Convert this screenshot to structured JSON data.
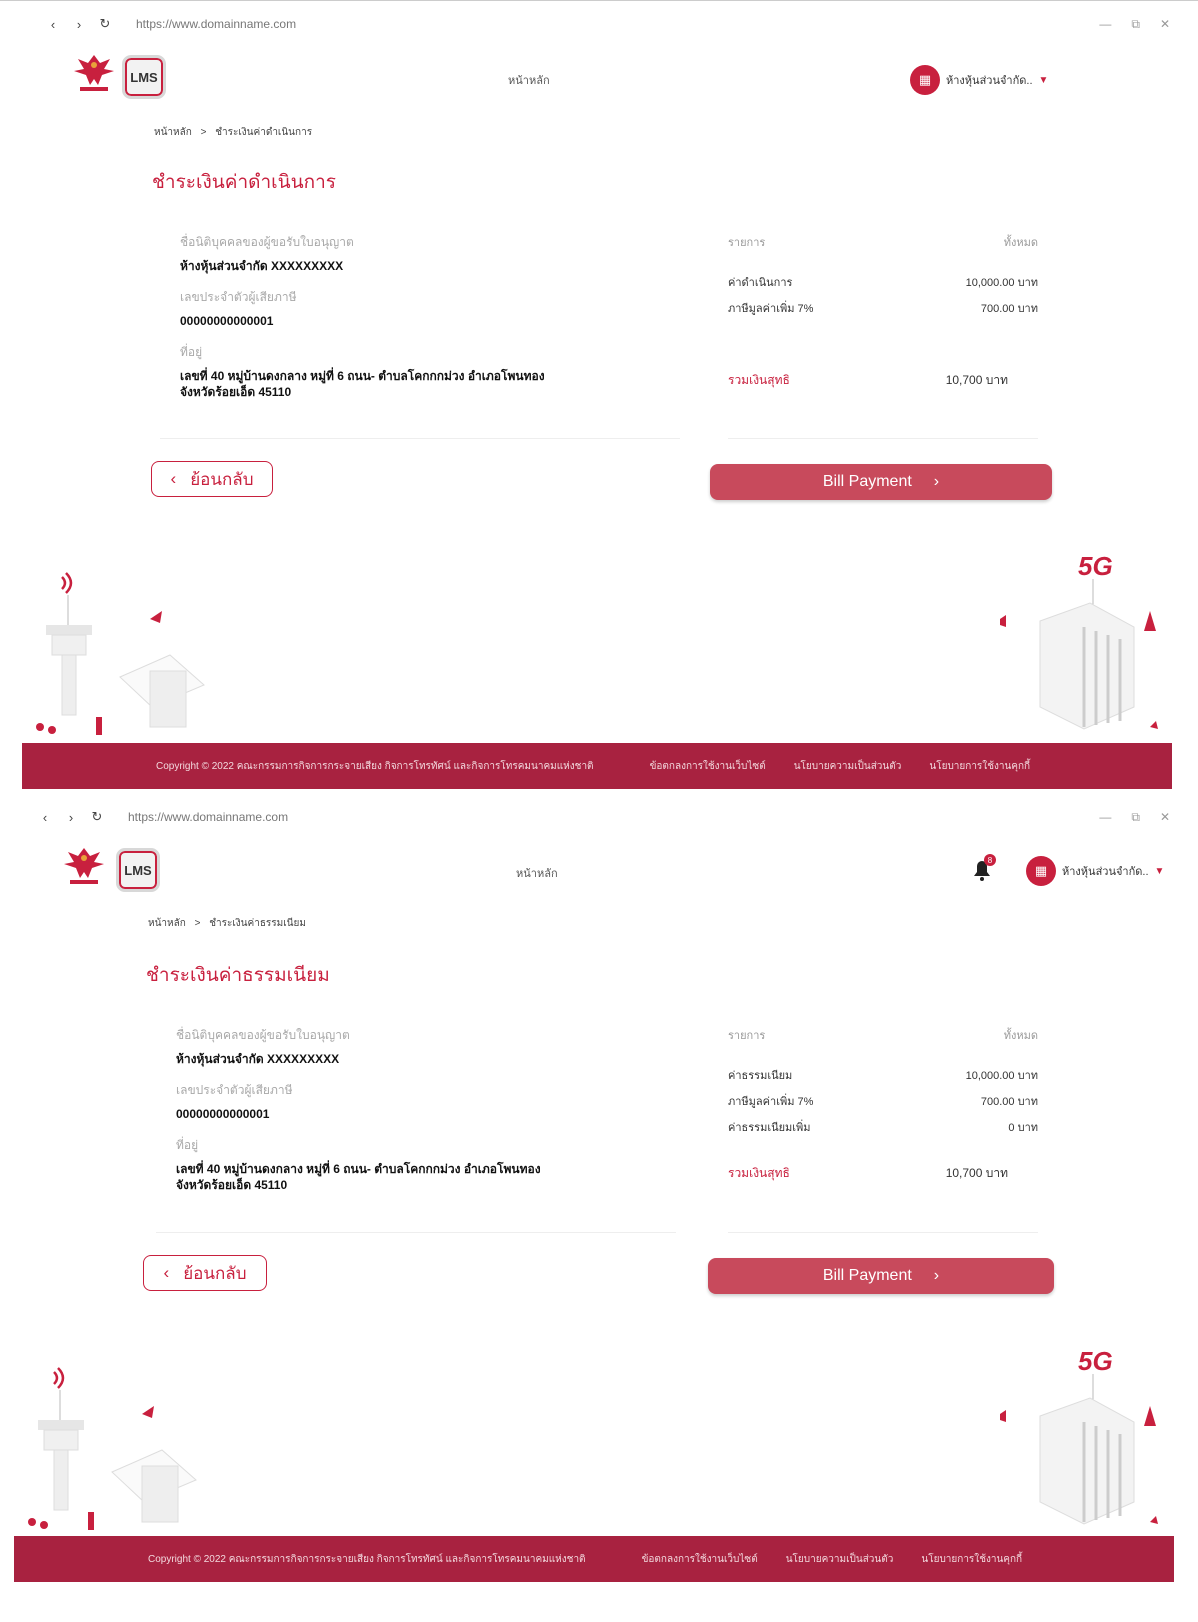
{
  "colors": {
    "accent": "#c8203e",
    "footer": "#a82240",
    "button": "#c84a5c"
  },
  "screens": [
    {
      "browser": {
        "url": "https://www.domainname.com"
      },
      "header": {
        "home_label": "หน้าหลัก",
        "org_label": "ห้างหุ้นส่วนจำกัด..",
        "lms_logo": "LMS"
      },
      "breadcrumb": {
        "home": "หน้าหลัก",
        "separator": ">",
        "current": "ชำระเงินค่าดำเนินการ"
      },
      "title": "ชำระเงินค่าดำเนินการ",
      "info": {
        "company_label": "ชื่อนิติบุคคลของผู้ขอรับใบอนุญาต",
        "company_value": "ห้างหุ้นส่วนจำกัด XXXXXXXXX",
        "taxid_label": "เลขประจำตัวผู้เสียภาษี",
        "taxid_value": "00000000000001",
        "address_label": "ที่อยู่",
        "address_line1": "เลขที่ 40 หมู่บ้านดงกลาง หมู่ที่ 6 ถนน- ตำบลโคกกกม่วง อำเภอโพนทอง",
        "address_line2": "จังหวัดร้อยเอ็ด 45110"
      },
      "fees": {
        "col_item": "รายการ",
        "col_total": "ทั้งหมด",
        "rows": [
          {
            "name": "ค่าดำเนินการ",
            "amount": "10,000.00 บาท"
          },
          {
            "name": "ภาษีมูลค่าเพิ่ม 7%",
            "amount": "700.00 บาท"
          }
        ],
        "total_label": "รวมเงินสุทธิ",
        "total_value": "10,700 บาท"
      },
      "buttons": {
        "back": "ย้อนกลับ",
        "bill": "Bill Payment"
      },
      "footer": {
        "copyright": "Copyright © 2022 คณะกรรมการกิจการกระจายเสียง กิจการโทรทัศน์ และกิจการโทรคมนาคมแห่งชาติ",
        "link1": "ข้อตกลงการใช้งานเว็บไซต์",
        "link2": "นโยบายความเป็นส่วนตัว",
        "link3": "นโยบายการใช้งานคุกกี้"
      },
      "illustration": {
        "badge": "5G"
      }
    },
    {
      "browser": {
        "url": "https://www.domainname.com"
      },
      "header": {
        "home_label": "หน้าหลัก",
        "org_label": "ห้างหุ้นส่วนจำกัด..",
        "lms_logo": "LMS",
        "bell_count": "8"
      },
      "breadcrumb": {
        "home": "หน้าหลัก",
        "separator": ">",
        "current": "ชำระเงินค่าธรรมเนียม"
      },
      "title": "ชำระเงินค่าธรรมเนียม",
      "info": {
        "company_label": "ชื่อนิติบุคคลของผู้ขอรับใบอนุญาต",
        "company_value": "ห้างหุ้นส่วนจำกัด XXXXXXXXX",
        "taxid_label": "เลขประจำตัวผู้เสียภาษี",
        "taxid_value": "00000000000001",
        "address_label": "ที่อยู่",
        "address_line1": "เลขที่ 40 หมู่บ้านดงกลาง หมู่ที่ 6 ถนน- ตำบลโคกกกม่วง อำเภอโพนทอง",
        "address_line2": "จังหวัดร้อยเอ็ด 45110"
      },
      "fees": {
        "col_item": "รายการ",
        "col_total": "ทั้งหมด",
        "rows": [
          {
            "name": "ค่าธรรมเนียม",
            "amount": "10,000.00 บาท"
          },
          {
            "name": "ภาษีมูลค่าเพิ่ม 7%",
            "amount": "700.00 บาท"
          },
          {
            "name": "ค่าธรรมเนียมเพิ่ม",
            "amount": "0 บาท"
          }
        ],
        "total_label": "รวมเงินสุทธิ",
        "total_value": "10,700 บาท"
      },
      "buttons": {
        "back": "ย้อนกลับ",
        "bill": "Bill Payment"
      },
      "footer": {
        "copyright": "Copyright © 2022 คณะกรรมการกิจการกระจายเสียง กิจการโทรทัศน์ และกิจการโทรคมนาคมแห่งชาติ",
        "link1": "ข้อตกลงการใช้งานเว็บไซต์",
        "link2": "นโยบายความเป็นส่วนตัว",
        "link3": "นโยบายการใช้งานคุกกี้"
      },
      "illustration": {
        "badge": "5G"
      }
    }
  ]
}
